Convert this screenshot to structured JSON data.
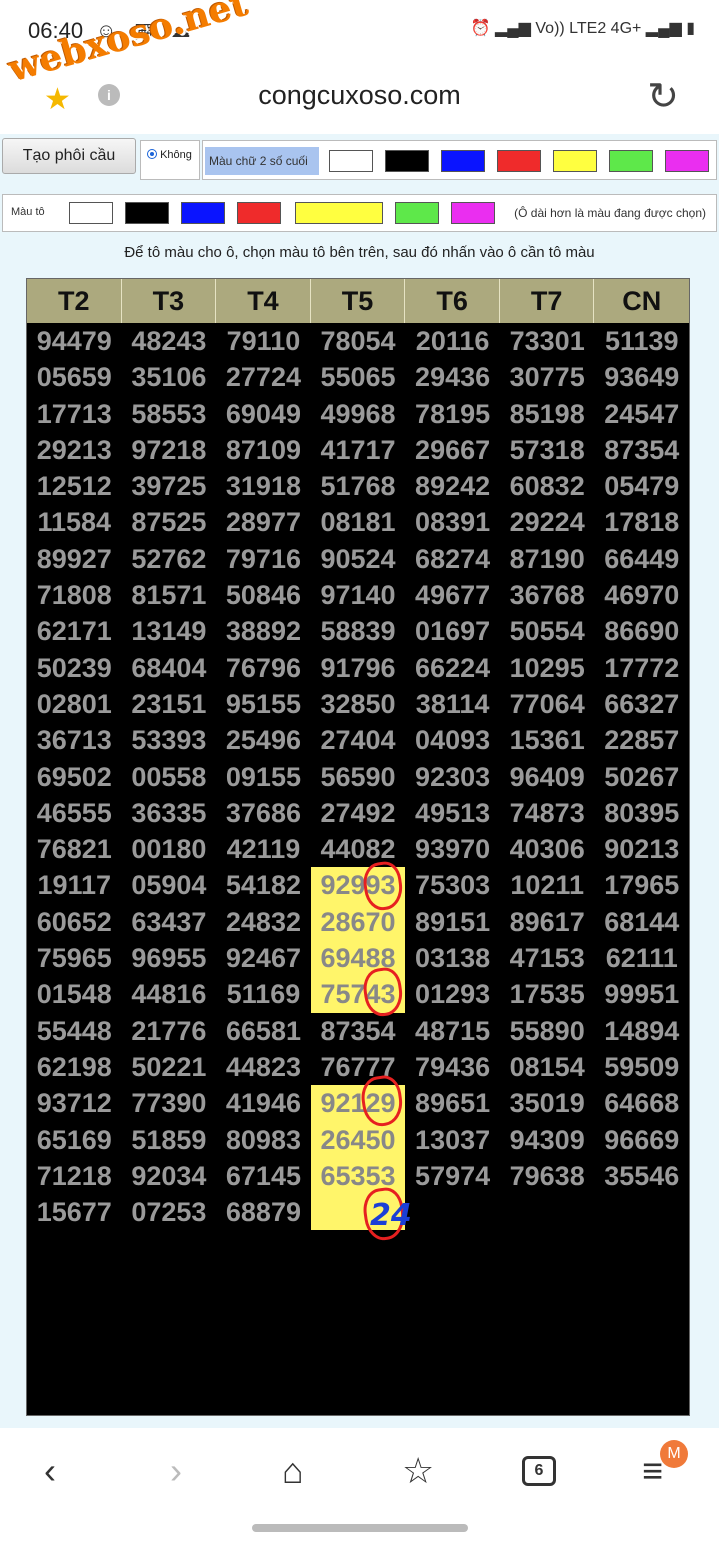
{
  "status": {
    "time": "06:40",
    "network": "Vo)) LTE2",
    "network_type": "4G+"
  },
  "watermark": "webxoso.net",
  "browser": {
    "url": "congcuxoso.com"
  },
  "controls": {
    "tao_phoi_cau": "Tạo phôi cầu",
    "radio_khong": "Không",
    "mau_chu_label": "Màu chữ 2 số cuối",
    "mau_to_label": "Màu tô",
    "mau_to_note": "(Ô dài hơn là màu đang được chọn)",
    "instruction": "Để tô màu cho ô, chọn màu tô bên trên, sau đó nhấn vào ô cần tô màu"
  },
  "palette": [
    "#ffffff",
    "#000000",
    "#0a14ff",
    "#ef2b2b",
    "#ffff40",
    "#5ee84a",
    "#ea2ef0"
  ],
  "table": {
    "headers": [
      "T2",
      "T3",
      "T4",
      "T5",
      "T6",
      "T7",
      "CN"
    ],
    "rows": [
      [
        "94479",
        "48243",
        "79110",
        "78054",
        "20116",
        "73301",
        "51139"
      ],
      [
        "05659",
        "35106",
        "27724",
        "55065",
        "29436",
        "30775",
        "93649"
      ],
      [
        "17713",
        "58553",
        "69049",
        "49968",
        "78195",
        "85198",
        "24547"
      ],
      [
        "29213",
        "97218",
        "87109",
        "41717",
        "29667",
        "57318",
        "87354"
      ],
      [
        "12512",
        "39725",
        "31918",
        "51768",
        "89242",
        "60832",
        "05479"
      ],
      [
        "11584",
        "87525",
        "28977",
        "08181",
        "08391",
        "29224",
        "17818"
      ],
      [
        "89927",
        "52762",
        "79716",
        "90524",
        "68274",
        "87190",
        "66449"
      ],
      [
        "71808",
        "81571",
        "50846",
        "97140",
        "49677",
        "36768",
        "46970"
      ],
      [
        "62171",
        "13149",
        "38892",
        "58839",
        "01697",
        "50554",
        "86690"
      ],
      [
        "50239",
        "68404",
        "76796",
        "91796",
        "66224",
        "10295",
        "17772"
      ],
      [
        "02801",
        "23151",
        "95155",
        "32850",
        "38114",
        "77064",
        "66327"
      ],
      [
        "36713",
        "53393",
        "25496",
        "27404",
        "04093",
        "15361",
        "22857"
      ],
      [
        "69502",
        "00558",
        "09155",
        "56590",
        "92303",
        "96409",
        "50267"
      ],
      [
        "46555",
        "36335",
        "37686",
        "27492",
        "49513",
        "74873",
        "80395"
      ],
      [
        "76821",
        "00180",
        "42119",
        "44082",
        "93970",
        "40306",
        "90213"
      ],
      [
        "19117",
        "05904",
        "54182",
        "92993",
        "75303",
        "10211",
        "17965"
      ],
      [
        "60652",
        "63437",
        "24832",
        "28670",
        "89151",
        "89617",
        "68144"
      ],
      [
        "75965",
        "96955",
        "92467",
        "69488",
        "03138",
        "47153",
        "62111"
      ],
      [
        "01548",
        "44816",
        "51169",
        "75743",
        "01293",
        "17535",
        "99951"
      ],
      [
        "55448",
        "21776",
        "66581",
        "87354",
        "48715",
        "55890",
        "14894"
      ],
      [
        "62198",
        "50221",
        "44823",
        "76777",
        "79436",
        "08154",
        "59509"
      ],
      [
        "93712",
        "77390",
        "41946",
        "92129",
        "89651",
        "35019",
        "64668"
      ],
      [
        "65169",
        "51859",
        "80983",
        "26450",
        "13037",
        "94309",
        "96669"
      ],
      [
        "71218",
        "92034",
        "67145",
        "65353",
        "57974",
        "79638",
        "35546"
      ],
      [
        "15677",
        "07253",
        "68879",
        "",
        "",
        "",
        ""
      ]
    ],
    "handwritten_note": "24"
  },
  "nav": {
    "tab_count": "6",
    "profile_badge": "M"
  }
}
